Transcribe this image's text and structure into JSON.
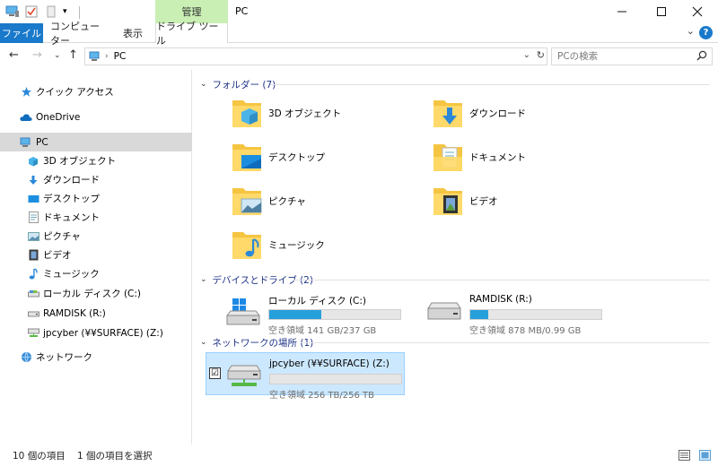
{
  "window": {
    "title": "PC",
    "context_tab": "管理"
  },
  "ribbon": {
    "tabs": [
      "ファイル",
      "コンピューター",
      "表示",
      "ドライブ ツール"
    ]
  },
  "address": {
    "path": "PC",
    "search_placeholder": "PCの検索"
  },
  "nav": {
    "items": [
      {
        "label": "クイック アクセス",
        "icon": "star-icon"
      },
      {
        "label": "OneDrive",
        "icon": "cloud-icon"
      },
      {
        "label": "PC",
        "icon": "pc-icon"
      },
      {
        "label": "3D オブジェクト",
        "icon": "cube-icon"
      },
      {
        "label": "ダウンロード",
        "icon": "download-icon"
      },
      {
        "label": "デスクトップ",
        "icon": "desktop-icon"
      },
      {
        "label": "ドキュメント",
        "icon": "document-icon"
      },
      {
        "label": "ピクチャ",
        "icon": "picture-icon"
      },
      {
        "label": "ビデオ",
        "icon": "video-icon"
      },
      {
        "label": "ミュージック",
        "icon": "music-icon"
      },
      {
        "label": "ローカル ディスク (C:)",
        "icon": "disk-icon"
      },
      {
        "label": "RAMDISK (R:)",
        "icon": "disk-icon"
      },
      {
        "label": "jpcyber (¥¥SURFACE) (Z:)",
        "icon": "network-drive-icon"
      },
      {
        "label": "ネットワーク",
        "icon": "network-icon"
      }
    ]
  },
  "groups": {
    "folders_header": "フォルダー (7)",
    "devices_header": "デバイスとドライブ (2)",
    "network_header": "ネットワークの場所 (1)"
  },
  "folders": [
    {
      "label": "3D オブジェクト"
    },
    {
      "label": "ダウンロード"
    },
    {
      "label": "デスクトップ"
    },
    {
      "label": "ドキュメント"
    },
    {
      "label": "ピクチャ"
    },
    {
      "label": "ビデオ"
    },
    {
      "label": "ミュージック"
    }
  ],
  "drives": [
    {
      "name": "ローカル ディスク (C:)",
      "free": "空き領域 141 GB/237 GB",
      "used_fraction": 0.4
    },
    {
      "name": "RAMDISK (R:)",
      "free": "空き領域 878 MB/0.99 GB",
      "used_fraction": 0.14
    }
  ],
  "network_locations": [
    {
      "name": "jpcyber (¥¥SURFACE) (Z:)",
      "free": "空き領域 256 TB/256 TB",
      "used_fraction": 0.0,
      "checked": "☑"
    }
  ],
  "status": {
    "item_count": "10 個の項目",
    "selected": "1 個の項目を選択"
  },
  "colors": {
    "accent": "#1979ca",
    "context_tab": "#c9efb4",
    "drive_bar": "#26a0da",
    "group_header": "#1e3287",
    "selection": "#cce8ff"
  }
}
